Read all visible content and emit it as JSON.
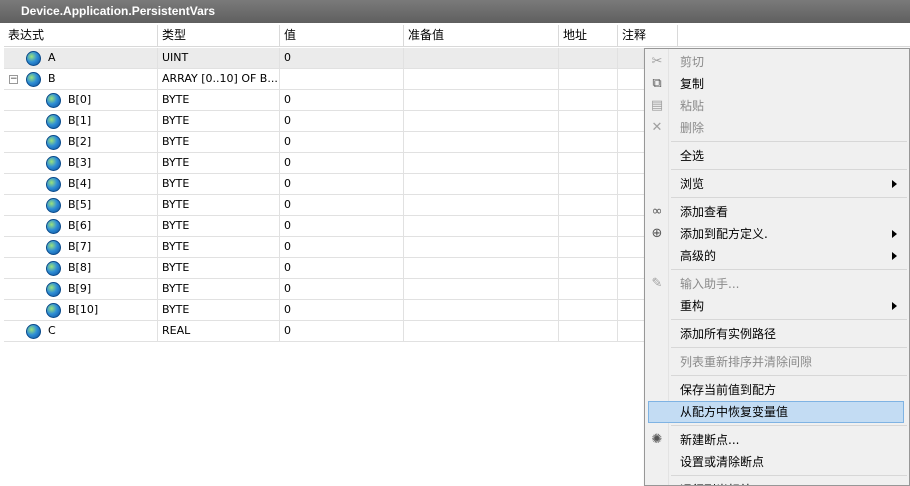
{
  "window": {
    "title": "Device.Application.PersistentVars"
  },
  "columns": [
    "表达式",
    "类型",
    "值",
    "准备值",
    "地址",
    "注释"
  ],
  "rows": [
    {
      "name": "A",
      "type": "UINT",
      "value": "0",
      "level": 0,
      "expander": ""
    },
    {
      "name": "B",
      "type": "ARRAY [0..10] OF B...",
      "value": "",
      "level": 0,
      "expander": "−"
    },
    {
      "name": "B[0]",
      "type": "BYTE",
      "value": "0",
      "level": 1,
      "expander": ""
    },
    {
      "name": "B[1]",
      "type": "BYTE",
      "value": "0",
      "level": 1,
      "expander": ""
    },
    {
      "name": "B[2]",
      "type": "BYTE",
      "value": "0",
      "level": 1,
      "expander": ""
    },
    {
      "name": "B[3]",
      "type": "BYTE",
      "value": "0",
      "level": 1,
      "expander": ""
    },
    {
      "name": "B[4]",
      "type": "BYTE",
      "value": "0",
      "level": 1,
      "expander": ""
    },
    {
      "name": "B[5]",
      "type": "BYTE",
      "value": "0",
      "level": 1,
      "expander": ""
    },
    {
      "name": "B[6]",
      "type": "BYTE",
      "value": "0",
      "level": 1,
      "expander": ""
    },
    {
      "name": "B[7]",
      "type": "BYTE",
      "value": "0",
      "level": 1,
      "expander": ""
    },
    {
      "name": "B[8]",
      "type": "BYTE",
      "value": "0",
      "level": 1,
      "expander": ""
    },
    {
      "name": "B[9]",
      "type": "BYTE",
      "value": "0",
      "level": 1,
      "expander": ""
    },
    {
      "name": "B[10]",
      "type": "BYTE",
      "value": "0",
      "level": 1,
      "expander": ""
    },
    {
      "name": "C",
      "type": "REAL",
      "value": "0",
      "level": 0,
      "expander": ""
    }
  ],
  "context_menu": {
    "items": [
      {
        "label": "剪切",
        "icon": "scissors-icon",
        "glyph": "✂",
        "disabled": true
      },
      {
        "label": "复制",
        "icon": "copy-icon",
        "glyph": "⧉",
        "disabled": false
      },
      {
        "label": "粘贴",
        "icon": "paste-icon",
        "glyph": "▤",
        "disabled": true
      },
      {
        "label": "删除",
        "icon": "delete-icon",
        "glyph": "✕",
        "disabled": true
      },
      {
        "sep": true
      },
      {
        "label": "全选",
        "disabled": false
      },
      {
        "sep": true
      },
      {
        "label": "浏览",
        "disabled": false,
        "submenu": true
      },
      {
        "sep": true
      },
      {
        "label": "添加查看",
        "icon": "glasses-icon",
        "glyph": "∞",
        "disabled": false
      },
      {
        "label": "添加到配方定义.",
        "icon": "recipe-add-icon",
        "glyph": "⊕",
        "disabled": false,
        "submenu": true
      },
      {
        "label": "高级的",
        "disabled": false,
        "submenu": true
      },
      {
        "sep": true
      },
      {
        "label": "输入助手...",
        "icon": "input-assistant-icon",
        "glyph": "✎",
        "disabled": true
      },
      {
        "label": "重构",
        "disabled": false,
        "submenu": true
      },
      {
        "sep": true
      },
      {
        "label": "添加所有实例路径",
        "disabled": false
      },
      {
        "sep": true
      },
      {
        "label": "列表重新排序并清除间隙",
        "disabled": true
      },
      {
        "sep": true
      },
      {
        "label": "保存当前值到配方",
        "disabled": false
      },
      {
        "label": "从配方中恢复变量值",
        "disabled": false,
        "highlighted": true
      },
      {
        "sep": true
      },
      {
        "label": "新建断点...",
        "icon": "new-breakpoint-icon",
        "glyph": "✺",
        "disabled": false
      },
      {
        "label": "设置或清除断点",
        "disabled": false
      },
      {
        "sep": true
      },
      {
        "label": "运行到光标处",
        "icon": "run-to-cursor-icon",
        "glyph": "➜",
        "disabled": false
      }
    ]
  },
  "colors": {
    "titlebar": "#6b6b6b",
    "selected_row": "#ebebeb",
    "menu_highlight": "#c3dcf3",
    "menu_bg": "#f0f0f0"
  }
}
